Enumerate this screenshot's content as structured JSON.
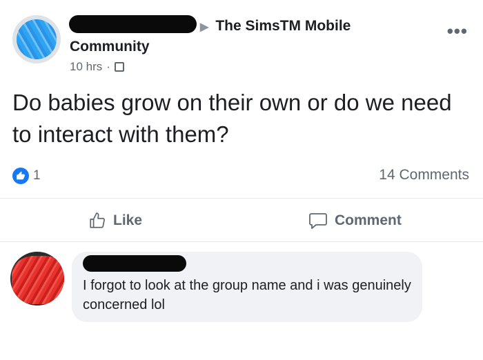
{
  "post": {
    "group_name": "The SimsTM Mobile",
    "group_name_cont": "Community",
    "time": "10 hrs",
    "separator": "·",
    "text": "Do babies grow on their own or do we need to interact with them?",
    "like_count": "1",
    "comment_count": "14 Comments",
    "more_glyph": "•••"
  },
  "actions": {
    "like_label": "Like",
    "comment_label": "Comment"
  },
  "comment": {
    "text": "I forgot to look at the group name and i was genuinely concerned lol"
  },
  "colors": {
    "like_blue": "#1877f2",
    "secondary_text": "#606770",
    "bubble_bg": "#f0f2f5"
  }
}
